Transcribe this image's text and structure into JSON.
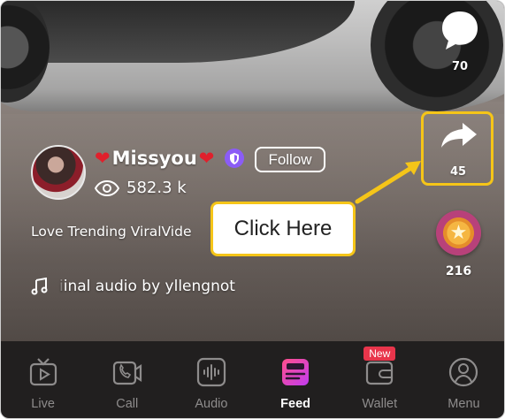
{
  "post": {
    "username": "Missyou",
    "follow_label": "Follow",
    "views": "582.3 k",
    "caption": "Love Trending ViralVide",
    "audio_visible": "inal audio by yllengnot",
    "audio_faded": "i"
  },
  "rail": {
    "comment_count": "70",
    "share_count": "45",
    "gift_count": "216"
  },
  "callout": {
    "label": "Click Here"
  },
  "nav": {
    "items": [
      {
        "label": "Live",
        "icon": "tv-icon"
      },
      {
        "label": "Call",
        "icon": "video-call-icon"
      },
      {
        "label": "Audio",
        "icon": "audio-wave-icon"
      },
      {
        "label": "Feed",
        "icon": "feed-icon"
      },
      {
        "label": "Wallet",
        "icon": "wallet-icon"
      },
      {
        "label": "Menu",
        "icon": "user-icon"
      }
    ],
    "active": "Feed",
    "wallet_badge": "New"
  },
  "colors": {
    "highlight": "#f5c518",
    "nav_bg": "#211f1f",
    "badge": "#e8354b",
    "verify": "#8b5cf6"
  }
}
